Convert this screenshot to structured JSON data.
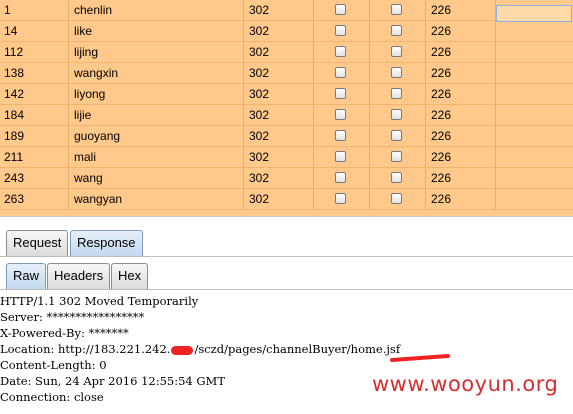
{
  "results": {
    "rows": [
      {
        "id": "1",
        "user": "chenlin",
        "status": "302",
        "length": "226"
      },
      {
        "id": "14",
        "user": "like",
        "status": "302",
        "length": "226"
      },
      {
        "id": "112",
        "user": "lijing",
        "status": "302",
        "length": "226"
      },
      {
        "id": "138",
        "user": "wangxin",
        "status": "302",
        "length": "226"
      },
      {
        "id": "142",
        "user": "liyong",
        "status": "302",
        "length": "226"
      },
      {
        "id": "184",
        "user": "lijie",
        "status": "302",
        "length": "226"
      },
      {
        "id": "189",
        "user": "guoyang",
        "status": "302",
        "length": "226"
      },
      {
        "id": "211",
        "user": "mali",
        "status": "302",
        "length": "226"
      },
      {
        "id": "243",
        "user": "wang",
        "status": "302",
        "length": "226"
      },
      {
        "id": "263",
        "user": "wangyan",
        "status": "302",
        "length": "226"
      }
    ],
    "row_color": "#ffc98b"
  },
  "tabs": {
    "request": "Request",
    "response": "Response",
    "raw": "Raw",
    "headers": "Headers",
    "hex": "Hex"
  },
  "response": {
    "line1": "HTTP/1.1 302 Moved Temporarily",
    "line2": "Server: *****************",
    "line3": "X-Powered-By: *******",
    "line4_prefix": "Location: http://183.221.242.",
    "line4_suffix": "/sczd/pages/channelBuyer/home.jsf",
    "line5": "Content-Length: 0",
    "line6": "Date: Sun, 24 Apr 2016 12:55:54 GMT",
    "line7": "Connection: close"
  },
  "watermark": "www.wooyun.org"
}
